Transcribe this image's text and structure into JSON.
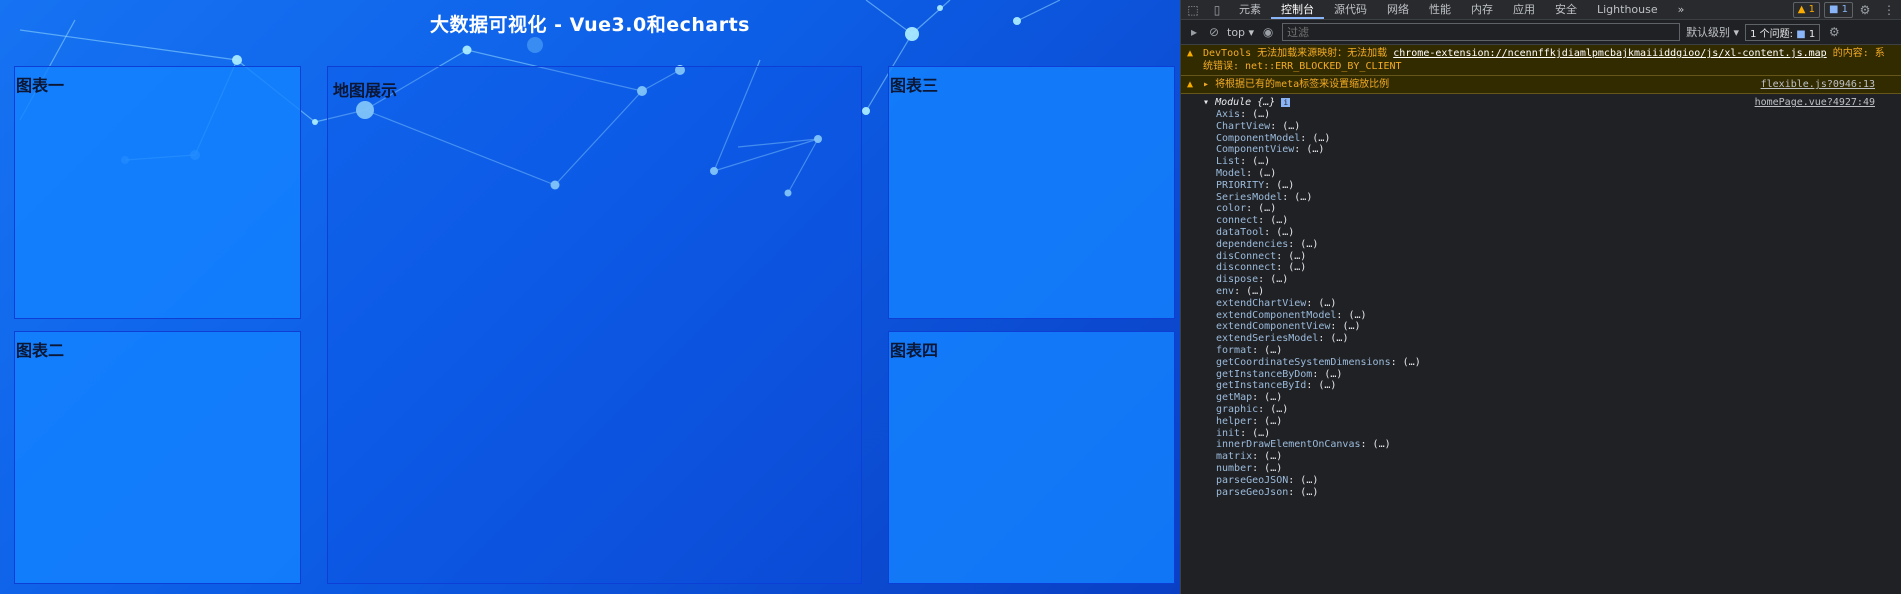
{
  "page": {
    "title": "大数据可视化 - Vue3.0和echarts",
    "panels": {
      "chart1": "图表一",
      "chart2": "图表二",
      "map": "地图展示",
      "chart3": "图表三",
      "chart4": "图表四"
    }
  },
  "devtools": {
    "tabs": [
      "元素",
      "控制台",
      "源代码",
      "网络",
      "性能",
      "内存",
      "应用",
      "安全",
      "Lighthouse"
    ],
    "active_tab": "控制台",
    "more_tabs": "»",
    "warning_count": "1",
    "message_count": "1",
    "toolbar": {
      "context": "top",
      "filter_placeholder": "过滤",
      "levels": "默认级别",
      "issues": "1 个问题:",
      "issues_count": "1"
    },
    "warnings": [
      {
        "prefix": "DevTools 无法加载来源映射：无法加载",
        "link": "chrome-extension://ncennffkjdiamlpmcbajkmaiiiddgioo/js/xl-content.js.map",
        "suffix": "的内容: 系统错误: net::ERR_BLOCKED_BY_CLIENT"
      },
      {
        "text": "将根据已有的meta标签来设置缩放比例",
        "source": "flexible.js?0946:13"
      }
    ],
    "log": {
      "label": "Module {…}",
      "source": "homePage.vue?4927:49",
      "props": [
        "Axis",
        "ChartView",
        "ComponentModel",
        "ComponentView",
        "List",
        "Model",
        "PRIORITY",
        "SeriesModel",
        "color",
        "connect",
        "dataTool",
        "dependencies",
        "disConnect",
        "disconnect",
        "dispose",
        "env",
        "extendChartView",
        "extendComponentModel",
        "extendComponentView",
        "extendSeriesModel",
        "format",
        "getCoordinateSystemDimensions",
        "getInstanceByDom",
        "getInstanceById",
        "getMap",
        "graphic",
        "helper",
        "init",
        "innerDrawElementOnCanvas",
        "matrix",
        "number",
        "parseGeoJSON",
        "parseGeoJson"
      ],
      "value": "(…)"
    }
  },
  "colors": {
    "page_bg": "#0d5ee6",
    "panel_bg": "#1482ff",
    "devtools_bg": "#202124",
    "warn_text": "#f2ab26",
    "prop_key": "#9bbbdc"
  }
}
